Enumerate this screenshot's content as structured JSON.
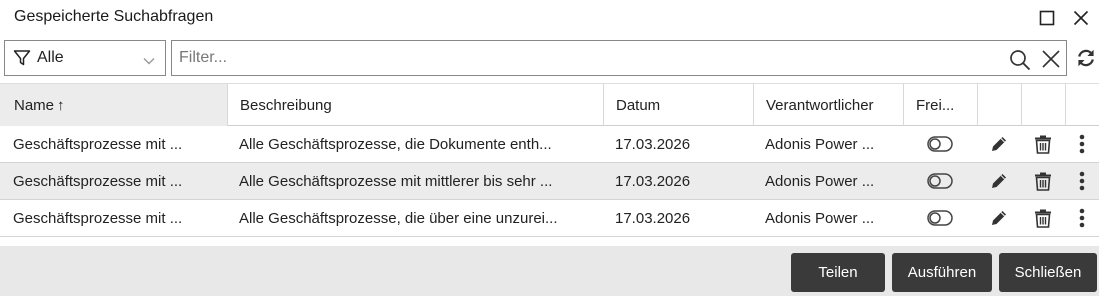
{
  "window": {
    "title": "Gespeicherte Suchabfragen"
  },
  "toolbar": {
    "filter_value": "Alle",
    "search_placeholder": "Filter...",
    "search_value": ""
  },
  "table": {
    "columns": [
      "Name",
      "Beschreibung",
      "Datum",
      "Verantwortlicher",
      "Frei..."
    ],
    "sort_indicator": "↑",
    "rows": [
      {
        "name": "Geschäftsprozesse mit ...",
        "description": "Alle Geschäftsprozesse, die Dokumente enth...",
        "date": "17.03.2026",
        "owner": "Adonis Power ..."
      },
      {
        "name": "Geschäftsprozesse mit ...",
        "description": "Alle Geschäftsprozesse mit mittlerer bis sehr ...",
        "date": "17.03.2026",
        "owner": "Adonis Power ..."
      },
      {
        "name": "Geschäftsprozesse mit ...",
        "description": "Alle Geschäftsprozesse, die über eine unzurei...",
        "date": "17.03.2026",
        "owner": "Adonis Power ..."
      }
    ]
  },
  "footer": {
    "share_label": "Teilen",
    "execute_label": "Ausführen",
    "close_label": "Schließen"
  },
  "colors": {
    "button_bg": "#3a3a3a",
    "footer_bg": "#e8e8e8",
    "selected_row_bg": "#ececec"
  }
}
